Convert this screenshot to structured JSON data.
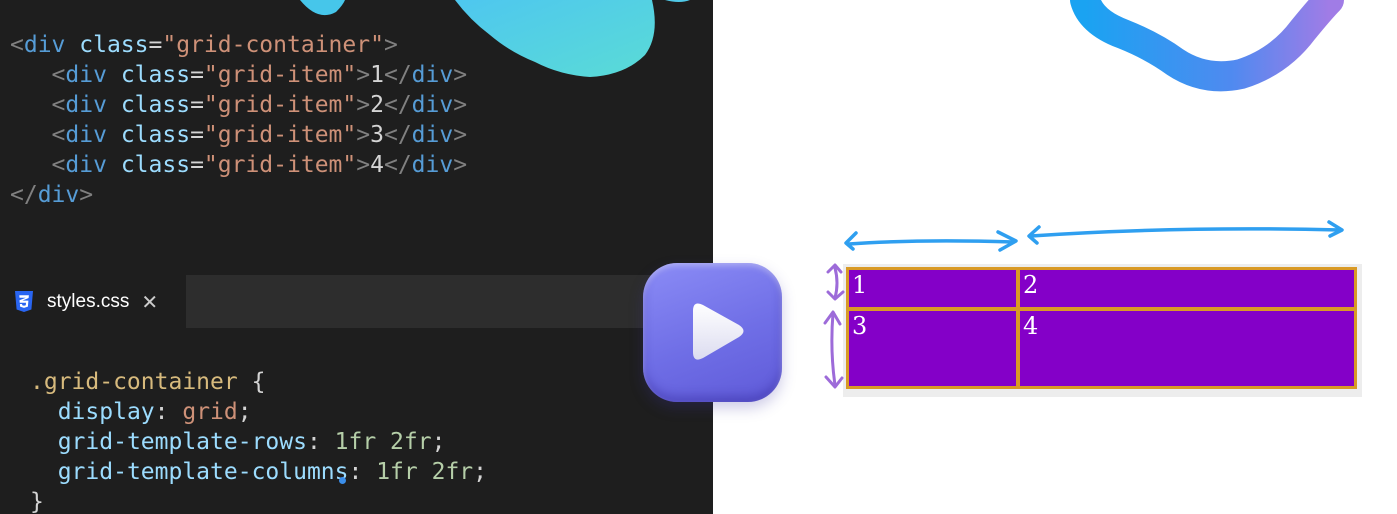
{
  "html_code": {
    "lines": [
      {
        "indent": "",
        "parts": [
          [
            "tk-punc",
            "<"
          ],
          [
            "tk-tag",
            "div"
          ],
          [
            "tk-text",
            " "
          ],
          [
            "tk-attr",
            "class"
          ],
          [
            "tk-text",
            "="
          ],
          [
            "tk-str",
            "\"grid-container\""
          ],
          [
            "tk-punc",
            ">"
          ]
        ]
      },
      {
        "indent": "   ",
        "parts": [
          [
            "tk-punc",
            "<"
          ],
          [
            "tk-tag",
            "div"
          ],
          [
            "tk-text",
            " "
          ],
          [
            "tk-attr",
            "class"
          ],
          [
            "tk-text",
            "="
          ],
          [
            "tk-str",
            "\"grid-item\""
          ],
          [
            "tk-punc",
            ">"
          ],
          [
            "tk-text",
            "1"
          ],
          [
            "tk-punc",
            "</"
          ],
          [
            "tk-tag",
            "div"
          ],
          [
            "tk-punc",
            ">"
          ]
        ]
      },
      {
        "indent": "   ",
        "parts": [
          [
            "tk-punc",
            "<"
          ],
          [
            "tk-tag",
            "div"
          ],
          [
            "tk-text",
            " "
          ],
          [
            "tk-attr",
            "class"
          ],
          [
            "tk-text",
            "="
          ],
          [
            "tk-str",
            "\"grid-item\""
          ],
          [
            "tk-punc",
            ">"
          ],
          [
            "tk-text",
            "2"
          ],
          [
            "tk-punc",
            "</"
          ],
          [
            "tk-tag",
            "div"
          ],
          [
            "tk-punc",
            ">"
          ]
        ]
      },
      {
        "indent": "   ",
        "parts": [
          [
            "tk-punc",
            "<"
          ],
          [
            "tk-tag",
            "div"
          ],
          [
            "tk-text",
            " "
          ],
          [
            "tk-attr",
            "class"
          ],
          [
            "tk-text",
            "="
          ],
          [
            "tk-str",
            "\"grid-item\""
          ],
          [
            "tk-punc",
            ">"
          ],
          [
            "tk-text",
            "3"
          ],
          [
            "tk-punc",
            "</"
          ],
          [
            "tk-tag",
            "div"
          ],
          [
            "tk-punc",
            ">"
          ]
        ]
      },
      {
        "indent": "   ",
        "parts": [
          [
            "tk-punc",
            "<"
          ],
          [
            "tk-tag",
            "div"
          ],
          [
            "tk-text",
            " "
          ],
          [
            "tk-attr",
            "class"
          ],
          [
            "tk-text",
            "="
          ],
          [
            "tk-str",
            "\"grid-item\""
          ],
          [
            "tk-punc",
            ">"
          ],
          [
            "tk-text",
            "4"
          ],
          [
            "tk-punc",
            "</"
          ],
          [
            "tk-tag",
            "div"
          ],
          [
            "tk-punc",
            ">"
          ]
        ]
      },
      {
        "indent": "",
        "parts": [
          [
            "tk-punc",
            "</"
          ],
          [
            "tk-tag",
            "div"
          ],
          [
            "tk-punc",
            ">"
          ]
        ]
      }
    ]
  },
  "tab": {
    "icon": "css3-icon",
    "label": "styles.css",
    "close_icon": "close-icon",
    "close_glyph": "✕"
  },
  "css_code": {
    "lines": [
      {
        "indent": "",
        "parts": [
          [
            "tk-sel",
            ".grid-container"
          ],
          [
            "tk-text",
            " {"
          ]
        ]
      },
      {
        "indent": "  ",
        "parts": [
          [
            "tk-prop",
            "display"
          ],
          [
            "tk-text",
            ": "
          ],
          [
            "tk-val",
            "grid"
          ],
          [
            "tk-text",
            ";"
          ]
        ]
      },
      {
        "indent": "  ",
        "parts": [
          [
            "tk-prop",
            "grid-template-rows"
          ],
          [
            "tk-text",
            ": "
          ],
          [
            "tk-num",
            "1fr 2fr"
          ],
          [
            "tk-text",
            ";"
          ]
        ]
      },
      {
        "indent": "  ",
        "parts": [
          [
            "tk-prop",
            "grid-template-columns"
          ],
          [
            "tk-text",
            ": "
          ],
          [
            "tk-num",
            "1fr 2fr"
          ],
          [
            "tk-text",
            ";"
          ]
        ]
      },
      {
        "indent": "",
        "parts": [
          [
            "tk-text",
            "}"
          ]
        ]
      }
    ]
  },
  "play_button": {
    "icon": "play-icon"
  },
  "grid_preview": {
    "items": [
      "1",
      "2",
      "3",
      "4"
    ],
    "item_color": "#8400c8",
    "gap_color": "#d99a26"
  },
  "colors": {
    "editor_bg": "#1e1e1e",
    "tabbar_bg": "#2d2d2d",
    "play_button": "#7677ea",
    "arrow_blue": "#2f9ff0",
    "arrow_purple": "#9d6bd9"
  }
}
